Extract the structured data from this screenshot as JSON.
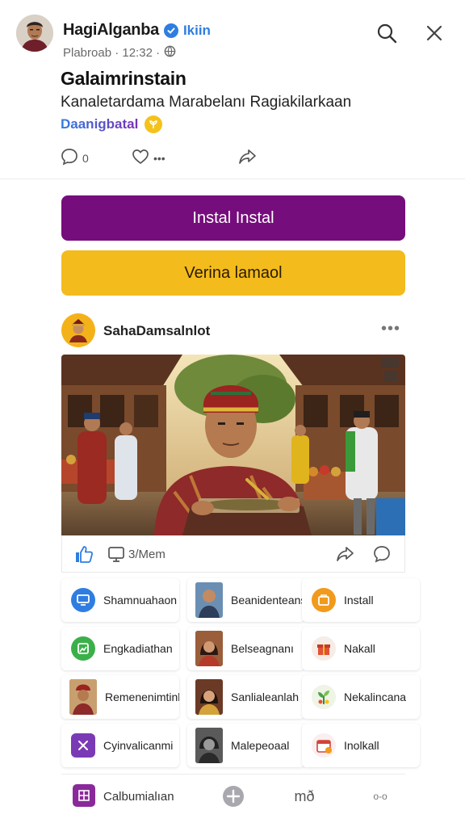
{
  "header": {
    "author_name": "HagiAlganba",
    "follow_label": "Ikiin",
    "post_meta": "Plabroab · 12:32 ·",
    "title": "Galaimrinstain",
    "description": "Kanaletardama Marabelanı Ragiakilarkaan",
    "hashtag": "Daanigbatal"
  },
  "reactions": {
    "comment_count": "0",
    "like_label": "•••"
  },
  "buttons": {
    "primary_label": "Instal Instal",
    "secondary_label": "Verina lamaol",
    "primary_color": "#760d7c",
    "secondary_color": "#f3bb1c"
  },
  "card": {
    "author": "SahaDamsalnlot",
    "more": "•••",
    "photo_overlay": " ",
    "action_label": "3/Mem"
  },
  "grid": [
    {
      "label": "Shamnuahaon",
      "icon": "blue-monitor-icon"
    },
    {
      "label": "Beanidenteans",
      "icon": "person-photo-thumb"
    },
    {
      "label": "Install",
      "icon": "orange-box-icon"
    },
    {
      "label": "Engkadiathan",
      "icon": "green-gallery-icon"
    },
    {
      "label": "Belseagnanı",
      "icon": "woman-photo-thumb"
    },
    {
      "label": "Nakall",
      "icon": "gift-icon"
    },
    {
      "label": "Remenenimtink",
      "icon": "man-hat-photo-thumb"
    },
    {
      "label": "Sanlialeanlah",
      "icon": "woman-photo-thumb-2"
    },
    {
      "label": "Nekalincana",
      "icon": "plant-icon"
    },
    {
      "label": "Cyinvalicanmi",
      "icon": "purple-app-icon"
    },
    {
      "label": "Malepeoaal",
      "icon": "bw-photo-thumb"
    },
    {
      "label": "Inolkall",
      "icon": "calendar-icon"
    }
  ],
  "bottom": {
    "label": "Calbumialıan",
    "center_label": "mð",
    "right_label": "o-o"
  }
}
